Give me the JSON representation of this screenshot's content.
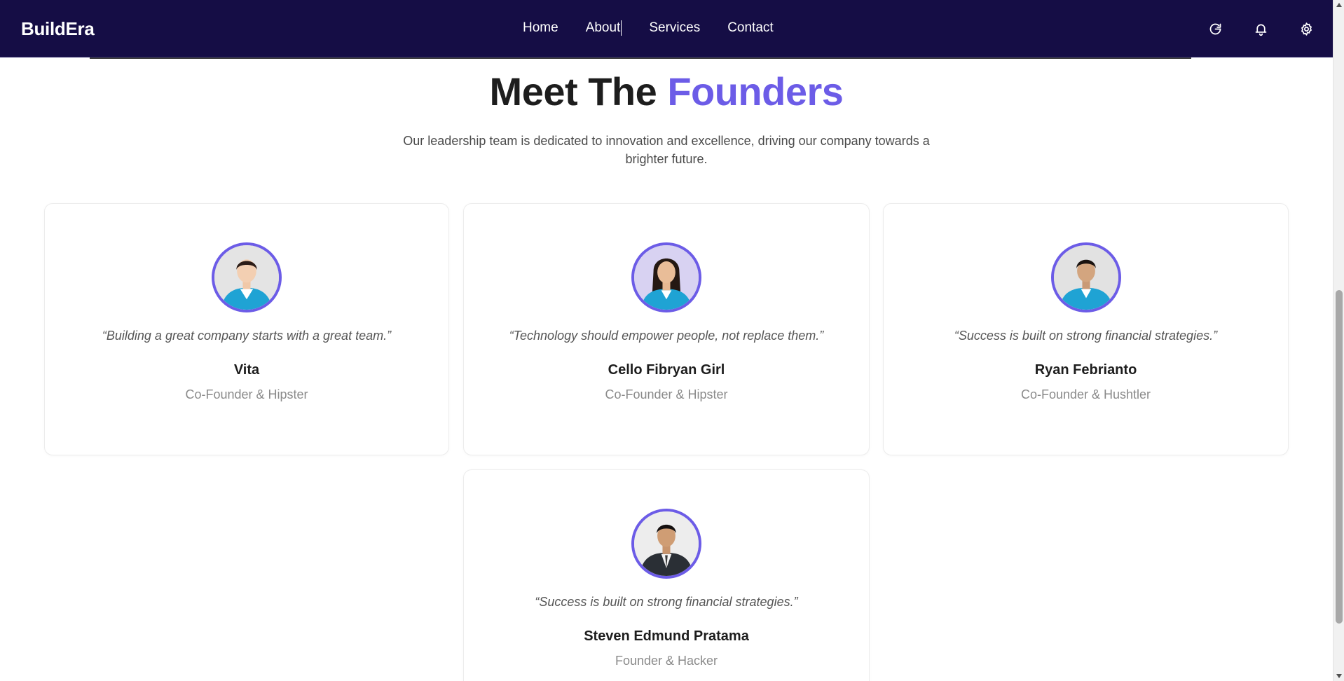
{
  "navbar": {
    "brand": "BuildEra",
    "links": [
      {
        "label": "Home"
      },
      {
        "label": "About"
      },
      {
        "label": "Services"
      },
      {
        "label": "Contact"
      }
    ],
    "icons": [
      "refresh-icon",
      "bell-icon",
      "gear-icon"
    ]
  },
  "hero": {
    "title_prefix": "Meet The",
    "title_accent": "Founders",
    "subtitle": "Our leadership team is dedicated to innovation and excellence, driving our company towards a brighter future."
  },
  "colors": {
    "navbar_bg": "#150d45",
    "accent": "#6c5ce7"
  },
  "founders": [
    {
      "quote": "“Building a great company starts with a great team.”",
      "name": "Vita",
      "role": "Co-Founder & Hipster"
    },
    {
      "quote": "“Technology should empower people, not replace them.”",
      "name": "Cello Fibryan Girl",
      "role": "Co-Founder & Hipster"
    },
    {
      "quote": "“Success is built on strong financial strategies.”",
      "name": "Ryan Febrianto",
      "role": "Co-Founder & Hushtler"
    },
    {
      "quote": "“Success is built on strong financial strategies.”",
      "name": "Steven Edmund Pratama",
      "role": "Founder & Hacker"
    }
  ]
}
